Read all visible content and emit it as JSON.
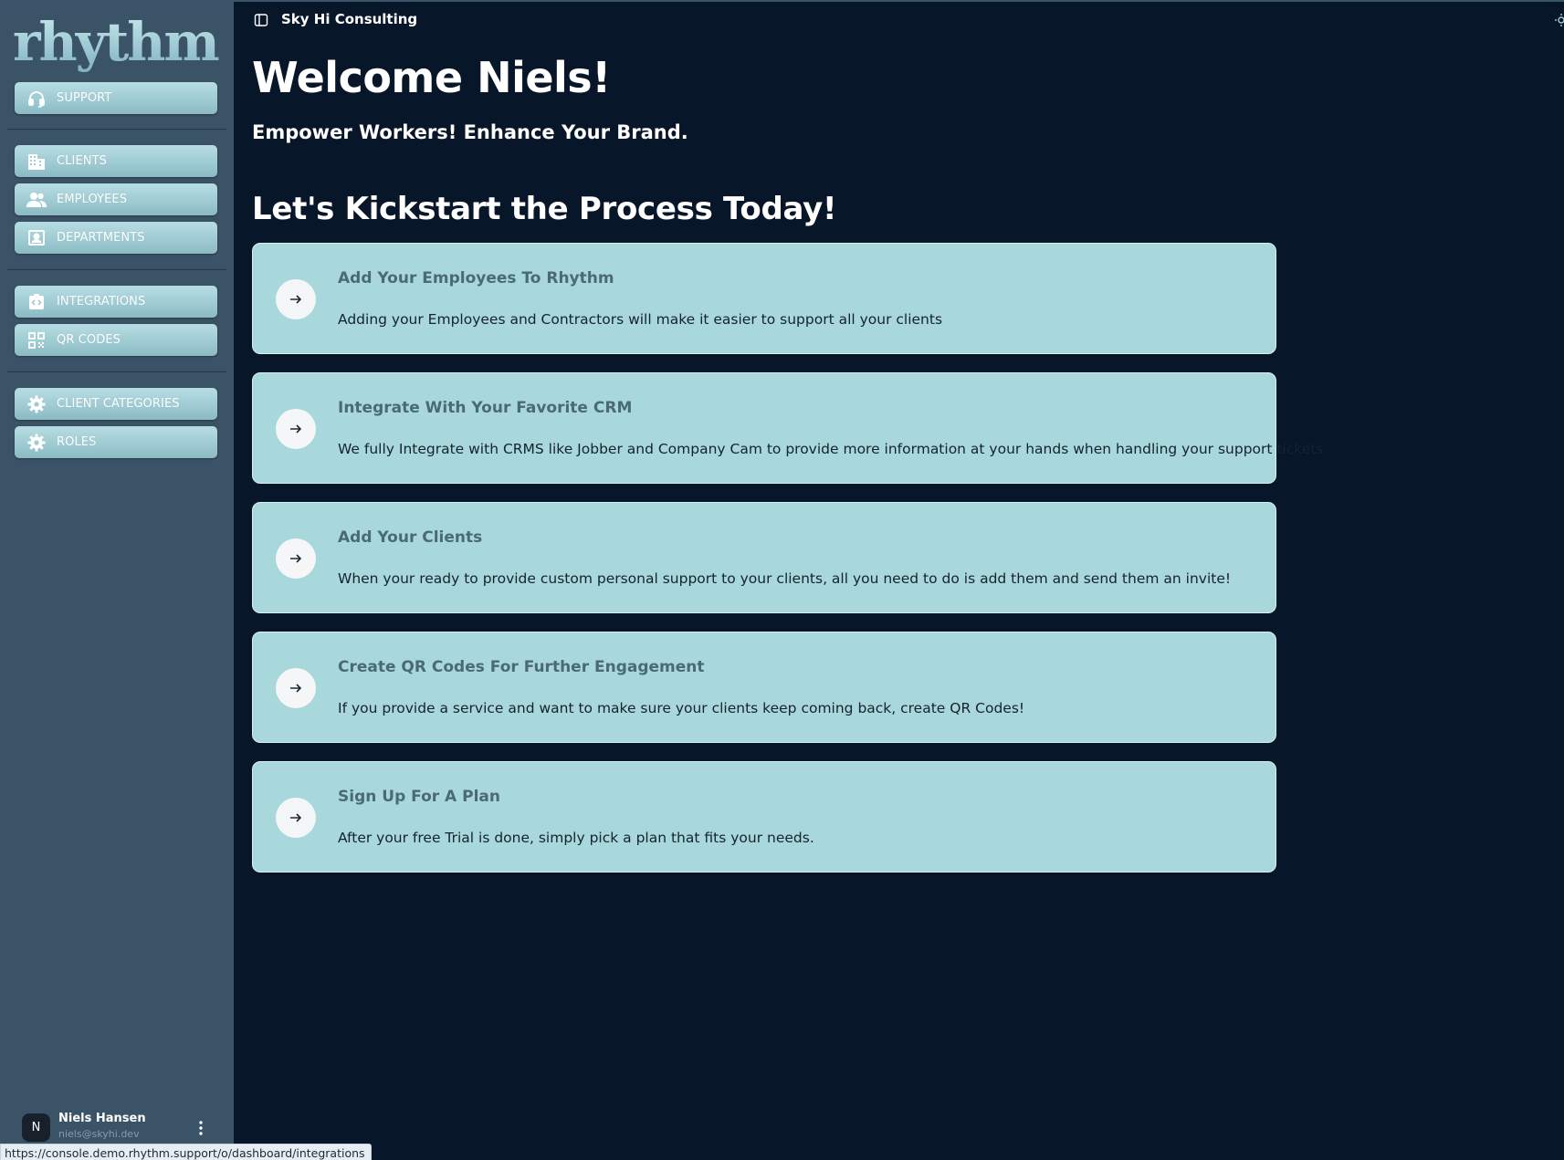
{
  "brand": {
    "logo_text": "rhythm"
  },
  "sidebar": {
    "groups": [
      [
        {
          "label": "SUPPORT",
          "icon": "headset-icon"
        }
      ],
      [
        {
          "label": "CLIENTS",
          "icon": "building-icon"
        },
        {
          "label": "EMPLOYEES",
          "icon": "people-icon"
        },
        {
          "label": "DEPARTMENTS",
          "icon": "contact-card-icon"
        }
      ],
      [
        {
          "label": "INTEGRATIONS",
          "icon": "integration-icon"
        },
        {
          "label": "QR CODES",
          "icon": "qr-code-icon"
        }
      ],
      [
        {
          "label": "CLIENT CATEGORIES",
          "icon": "gear-icon"
        },
        {
          "label": "ROLES",
          "icon": "gear-icon"
        }
      ]
    ],
    "user": {
      "initial": "N",
      "name": "Niels Hansen",
      "email": "niels@skyhi.dev"
    }
  },
  "topbar": {
    "title": "Sky Hi Consulting"
  },
  "main": {
    "welcome": "Welcome Niels!",
    "tagline": "Empower Workers! Enhance Your Brand.",
    "kickstart": "Let's Kickstart the Process Today!",
    "cards": [
      {
        "title": "Add Your Employees To Rhythm",
        "desc": "Adding your Employees and Contractors will make it easier to support all your clients"
      },
      {
        "title": "Integrate With Your Favorite CRM",
        "desc": "We fully Integrate with CRMS like Jobber and Company Cam to provide more information at your hands when handling your support tickets"
      },
      {
        "title": "Add Your Clients",
        "desc": "When your ready to provide custom personal support to your clients, all you need to do is add them and send them an invite!"
      },
      {
        "title": "Create QR Codes For Further Engagement",
        "desc": "If you provide a service and want to make sure your clients keep coming back, create QR Codes!"
      },
      {
        "title": "Sign Up For A Plan",
        "desc": "After your free Trial is done, simply pick a plan that fits your needs."
      }
    ]
  },
  "status_bar": {
    "url": "https://console.demo.rhythm.support/o/dashboard/integrations"
  },
  "colors": {
    "background": "#071628",
    "sidebar": "#3b5366",
    "nav_button": "#a3cfd6",
    "card": "#a8d8db",
    "card_title": "#4b6a78"
  }
}
